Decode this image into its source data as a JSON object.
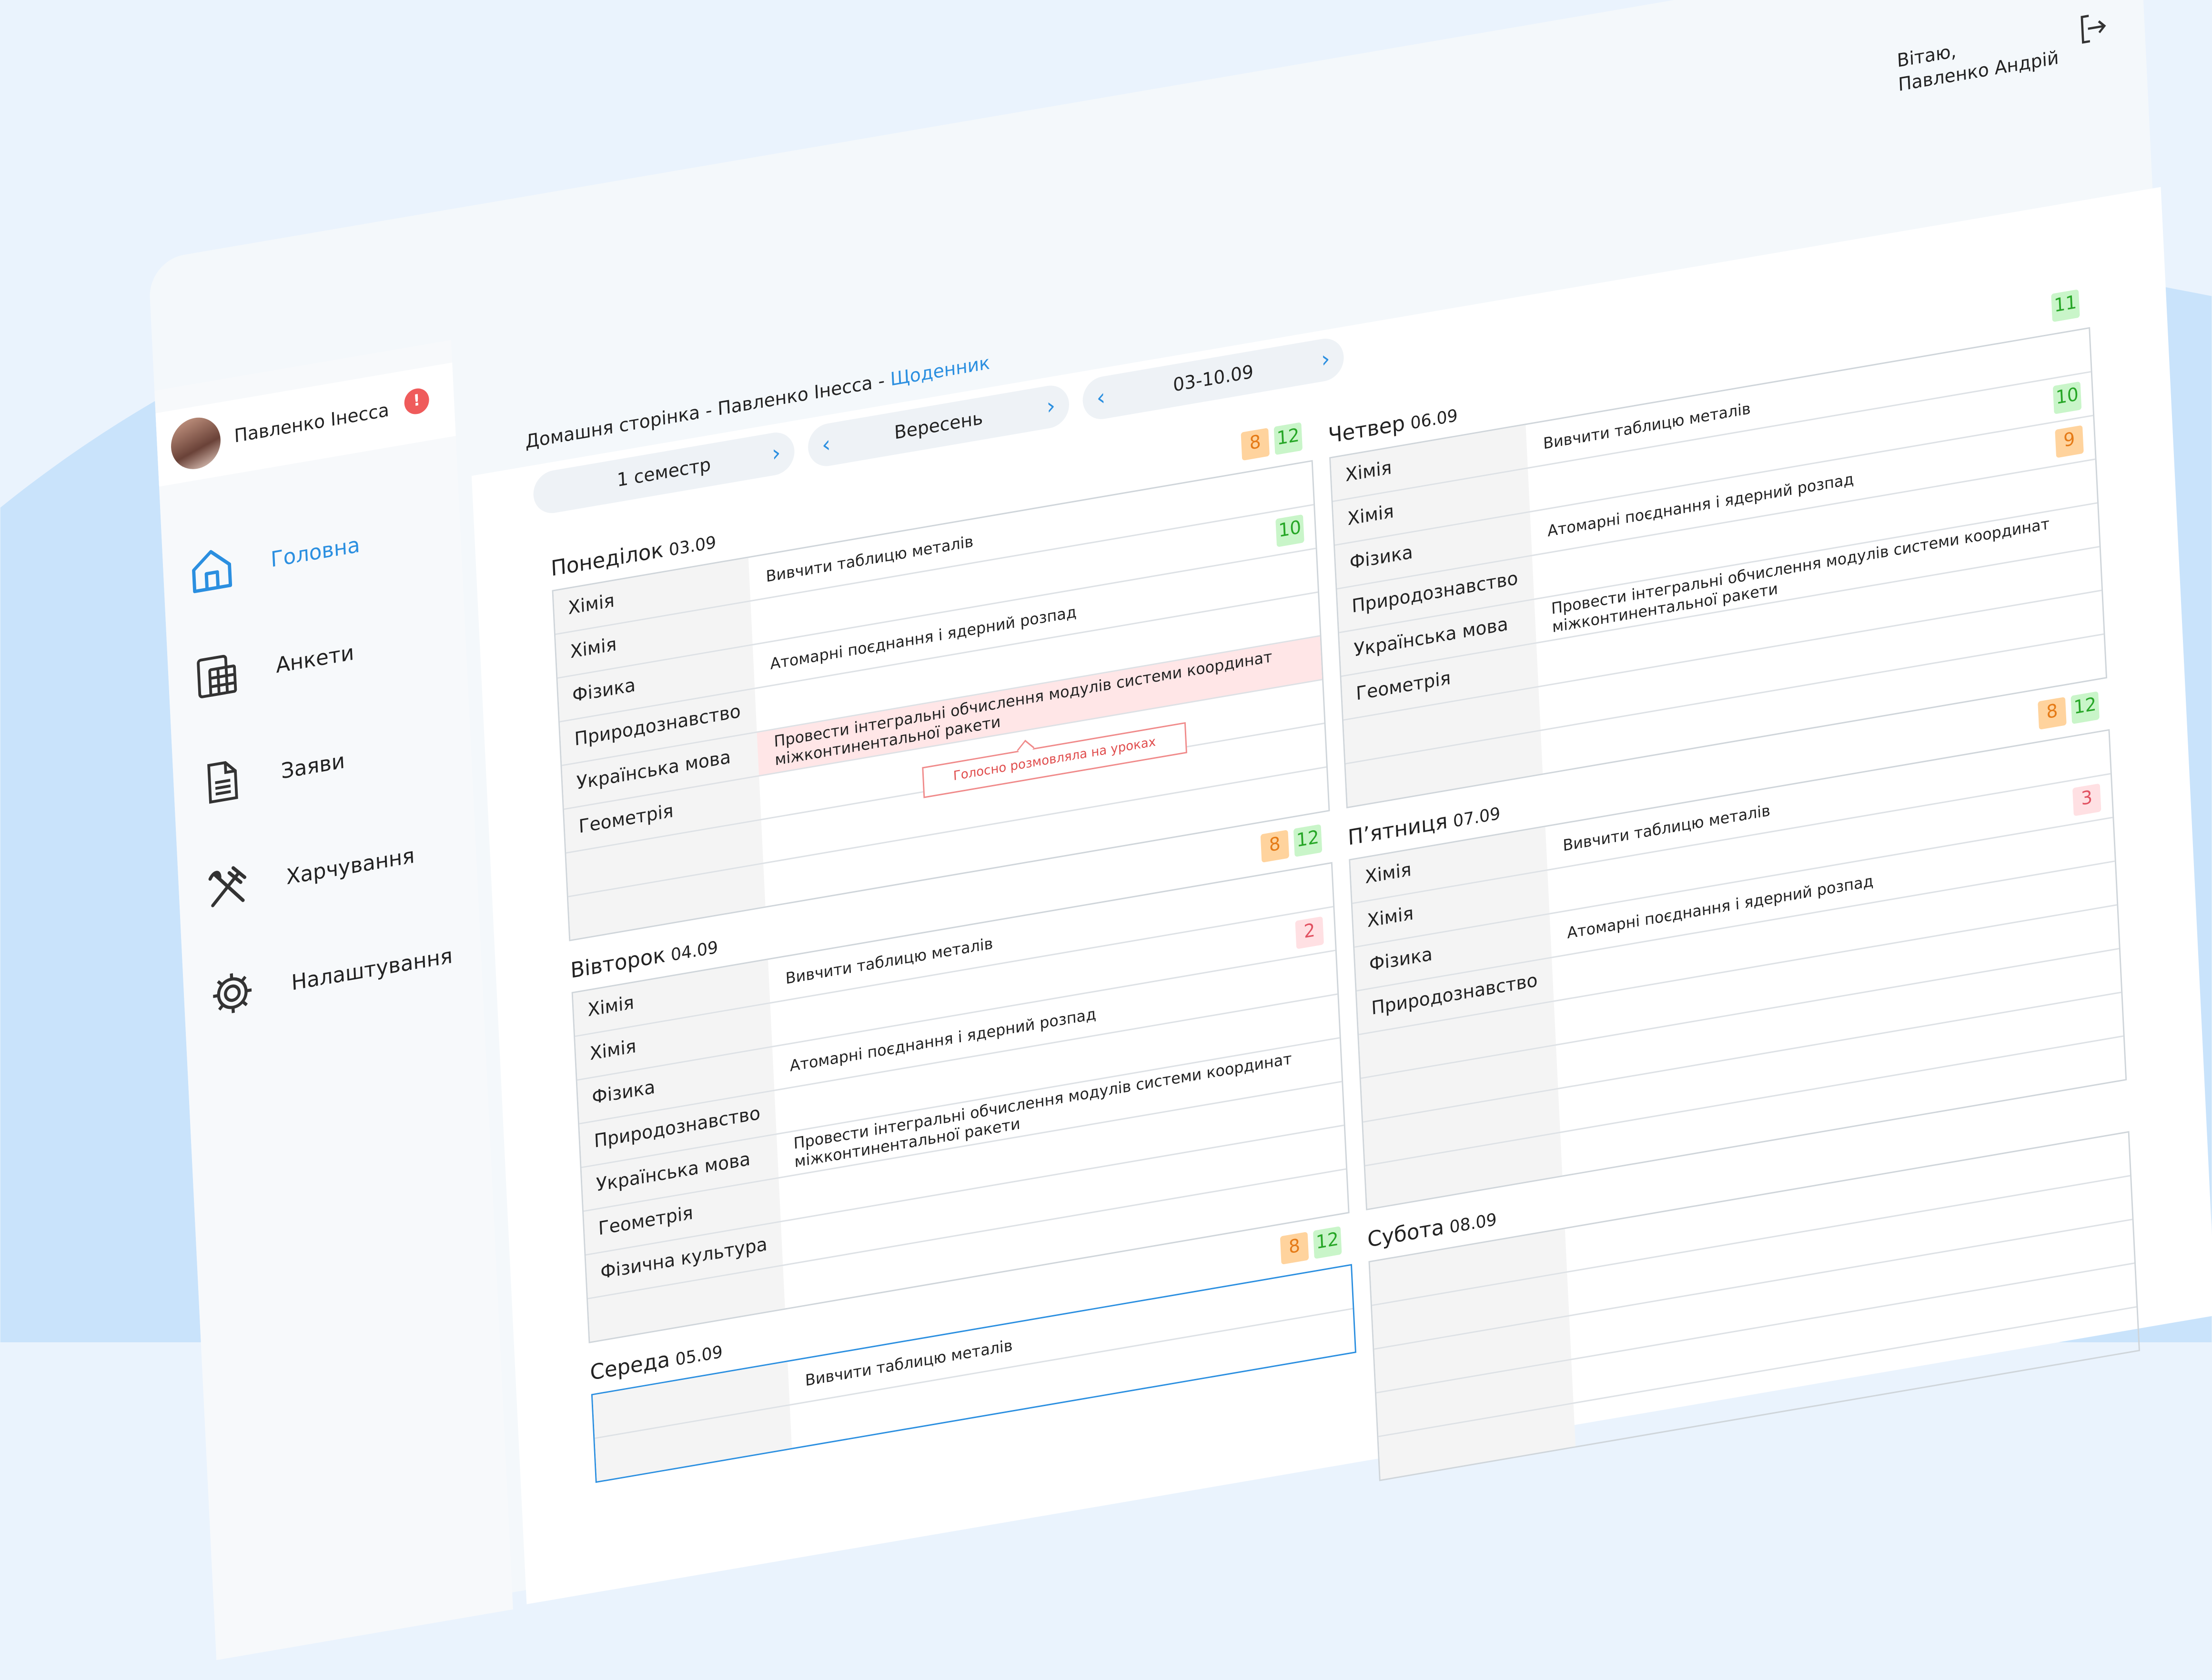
{
  "header": {
    "greeting_line1": "Вітаю,",
    "greeting_line2": "Павленко Андрій",
    "logout_icon": "logout-icon"
  },
  "profile": {
    "name": "Павленко Інесса",
    "alert": "!"
  },
  "nav": [
    {
      "label": "Головна",
      "icon": "home-icon",
      "active": true
    },
    {
      "label": "Анкети",
      "icon": "calculator-icon"
    },
    {
      "label": "Заяви",
      "icon": "document-icon"
    },
    {
      "label": "Харчування",
      "icon": "fork-knife-icon"
    },
    {
      "label": "Налаштування",
      "icon": "gear-icon"
    }
  ],
  "breadcrumb": {
    "part1": "Домашня сторінка",
    "part2": "Павленко Інесса",
    "current": "Щоденник",
    "sep": " - "
  },
  "selectors": {
    "semester": "1 семестр",
    "month": "Вересень",
    "week": "03-10.09"
  },
  "days": [
    {
      "name": "Понеділок",
      "date": "03.09",
      "grades": [
        {
          "v": "8",
          "c": "orange"
        },
        {
          "v": "12",
          "c": "green"
        }
      ],
      "rows": [
        {
          "subject": "Хімія",
          "task": "Вивчити таблицю металів"
        },
        {
          "subject": "Хімія",
          "task": "",
          "grade": {
            "v": "10",
            "c": "green"
          }
        },
        {
          "subject": "Фізика",
          "task": "Атомарні поєднання і ядерний розпад"
        },
        {
          "subject": "Природознавство",
          "task": ""
        },
        {
          "subject": "Українська мова",
          "task": "Провести інтегральні обчислення модулів системи координат міжконтинентальної ракети",
          "pink": true,
          "tooltip": "Голосно розмовляла на уроках"
        },
        {
          "subject": "Геометрія",
          "task": ""
        },
        {
          "subject": "",
          "task": ""
        },
        {
          "subject": "",
          "task": ""
        }
      ]
    },
    {
      "name": "Вівторок",
      "date": "04.09",
      "grades": [
        {
          "v": "8",
          "c": "orange"
        },
        {
          "v": "12",
          "c": "green"
        }
      ],
      "rows": [
        {
          "subject": "Хімія",
          "task": "Вивчити таблицю металів"
        },
        {
          "subject": "Хімія",
          "task": "",
          "grade": {
            "v": "2",
            "c": "red"
          }
        },
        {
          "subject": "Фізика",
          "task": "Атомарні поєднання і ядерний розпад"
        },
        {
          "subject": "Природознавство",
          "task": ""
        },
        {
          "subject": "Українська мова",
          "task": "Провести інтегральні обчислення модулів системи координат міжконтинентальної ракети"
        },
        {
          "subject": "Геометрія",
          "task": ""
        },
        {
          "subject": "Фізична культура",
          "task": ""
        },
        {
          "subject": "",
          "task": ""
        }
      ]
    },
    {
      "name": "Середа",
      "date": "05.09",
      "highlight": true,
      "grades": [
        {
          "v": "8",
          "c": "orange"
        },
        {
          "v": "12",
          "c": "green"
        }
      ],
      "rows": [
        {
          "subject": "",
          "task": "Вивчити таблицю металів"
        },
        {
          "subject": "",
          "task": ""
        }
      ]
    },
    {
      "name": "Четвер",
      "date": "06.09",
      "grades": [
        {
          "v": "11",
          "c": "green"
        }
      ],
      "rows": [
        {
          "subject": "Хімія",
          "task": "Вивчити таблицю металів"
        },
        {
          "subject": "Хімія",
          "task": "",
          "grade": {
            "v": "10",
            "c": "green"
          }
        },
        {
          "subject": "Фізика",
          "task": "Атомарні поєднання і ядерний розпад",
          "grade": {
            "v": "9",
            "c": "orange"
          }
        },
        {
          "subject": "Природознавство",
          "task": ""
        },
        {
          "subject": "Українська мова",
          "task": "Провести інтегральні обчислення модулів системи координат міжконтинентальної ракети"
        },
        {
          "subject": "Геометрія",
          "task": ""
        },
        {
          "subject": "",
          "task": ""
        },
        {
          "subject": "",
          "task": ""
        }
      ]
    },
    {
      "name": "П’ятниця",
      "date": "07.09",
      "grades": [
        {
          "v": "8",
          "c": "orange"
        },
        {
          "v": "12",
          "c": "green"
        }
      ],
      "rows": [
        {
          "subject": "Хімія",
          "task": "Вивчити таблицю металів"
        },
        {
          "subject": "Хімія",
          "task": "",
          "grade": {
            "v": "3",
            "c": "red"
          }
        },
        {
          "subject": "Фізика",
          "task": "Атомарні поєднання і ядерний розпад"
        },
        {
          "subject": "Природознавство",
          "task": ""
        },
        {
          "subject": "",
          "task": ""
        },
        {
          "subject": "",
          "task": ""
        },
        {
          "subject": "",
          "task": ""
        },
        {
          "subject": "",
          "task": ""
        }
      ]
    },
    {
      "name": "Субота",
      "date": "08.09",
      "grades": [],
      "rows": [
        {
          "subject": "",
          "task": ""
        },
        {
          "subject": "",
          "task": ""
        },
        {
          "subject": "",
          "task": ""
        },
        {
          "subject": "",
          "task": ""
        },
        {
          "subject": "",
          "task": ""
        }
      ]
    }
  ],
  "colors": {
    "accent": "#2b8fe0",
    "grade_green": "#26a626",
    "grade_orange": "#e57a16",
    "grade_red": "#e15161",
    "remark_bg": "#ffe6e7"
  }
}
